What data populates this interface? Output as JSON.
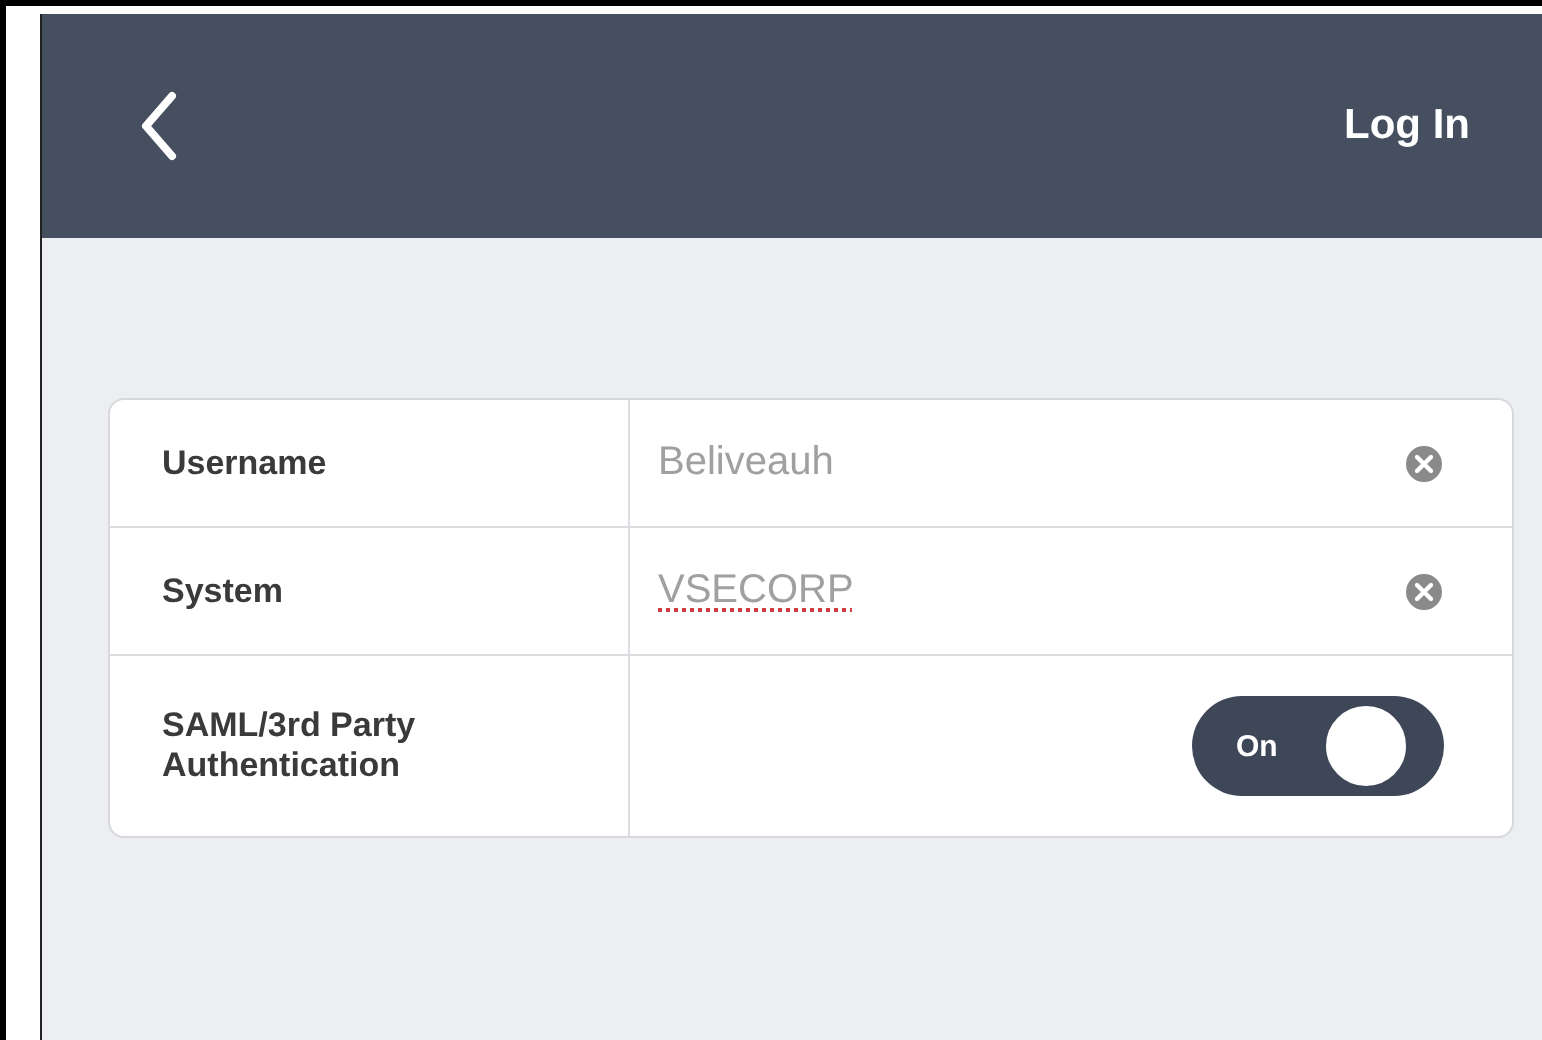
{
  "header": {
    "action": "Log In"
  },
  "fields": [
    {
      "kind": "text",
      "label": "Username",
      "value": "Beliveauh",
      "spellcheck_error": false
    },
    {
      "kind": "text",
      "label": "System",
      "value": "VSECORP",
      "spellcheck_error": true
    },
    {
      "kind": "toggle",
      "label": "SAML/3rd Party Authentication",
      "on": true,
      "state_label": "On"
    }
  ]
}
